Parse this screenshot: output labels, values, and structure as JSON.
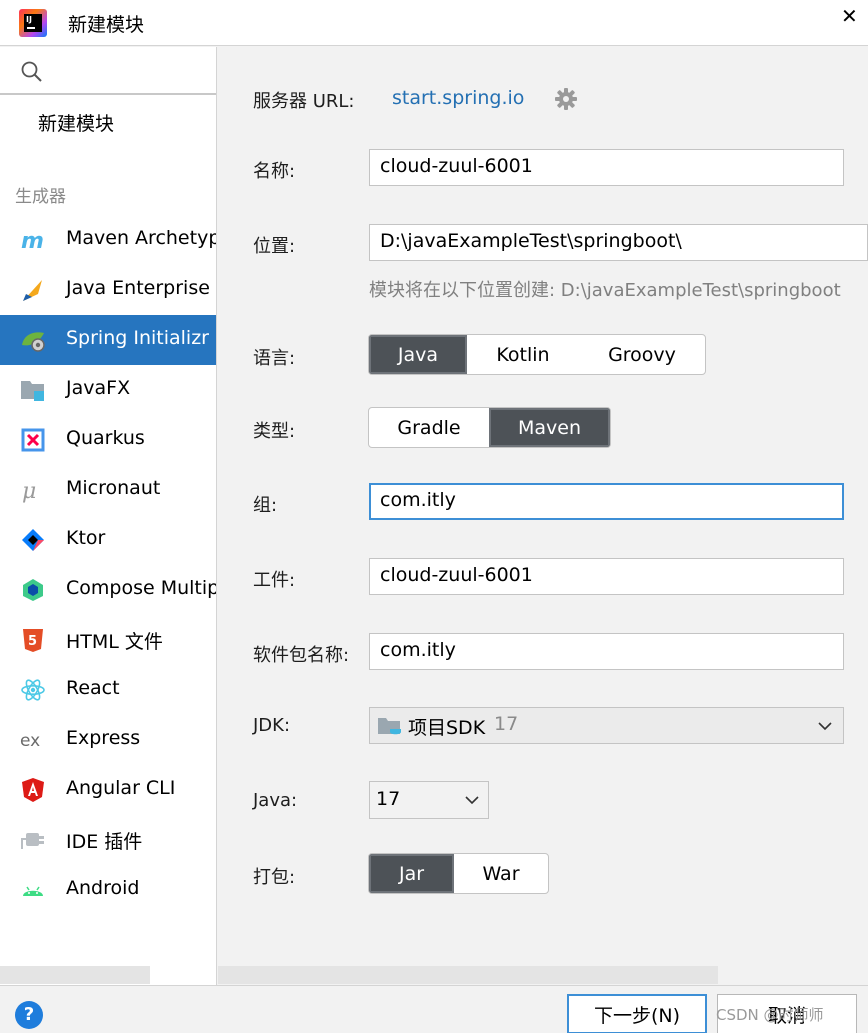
{
  "window": {
    "title": "新建模块",
    "close_glyph": "✕",
    "app_icon": "intellij-idea-icon",
    "logo_text": "IJ"
  },
  "sidebar": {
    "search_icon": "search-icon",
    "new_module_label": "新建模块",
    "group_label": "生成器",
    "generators": [
      {
        "label": "Maven Archetype",
        "icon": "maven-icon",
        "selected": false
      },
      {
        "label": "Java Enterprise",
        "icon": "java-enterprise-icon",
        "selected": false
      },
      {
        "label": "Spring Initializr",
        "icon": "spring-icon",
        "selected": true
      },
      {
        "label": "JavaFX",
        "icon": "javafx-icon",
        "selected": false
      },
      {
        "label": "Quarkus",
        "icon": "quarkus-icon",
        "selected": false
      },
      {
        "label": "Micronaut",
        "icon": "micronaut-icon",
        "selected": false
      },
      {
        "label": "Ktor",
        "icon": "ktor-icon",
        "selected": false
      },
      {
        "label": "Compose Multiplatform",
        "icon": "compose-icon",
        "selected": false
      },
      {
        "label": "HTML 文件",
        "icon": "html5-icon",
        "selected": false
      },
      {
        "label": "React",
        "icon": "react-icon",
        "selected": false
      },
      {
        "label": "Express",
        "icon": "express-icon",
        "selected": false
      },
      {
        "label": "Angular CLI",
        "icon": "angular-icon",
        "selected": false
      },
      {
        "label": "IDE 插件",
        "icon": "plugin-icon",
        "selected": false
      },
      {
        "label": "Android",
        "icon": "android-icon",
        "selected": false
      }
    ]
  },
  "form": {
    "server_url_label": "服务器 URL:",
    "server_url_value": "start.spring.io",
    "name_label": "名称:",
    "name_value": "cloud-zuul-6001",
    "location_label": "位置:",
    "location_value": "D:\\javaExampleTest\\springboot\\",
    "location_hint": "模块将在以下位置创建: D:\\javaExampleTest\\springboot",
    "language_label": "语言:",
    "language_options": [
      "Java",
      "Kotlin",
      "Groovy"
    ],
    "language_selected": "Java",
    "type_label": "类型:",
    "type_options": [
      "Gradle",
      "Maven"
    ],
    "type_selected": "Maven",
    "group_label": "组:",
    "group_value": "com.itly",
    "artifact_label": "工件:",
    "artifact_value": "cloud-zuul-6001",
    "package_label": "软件包名称:",
    "package_value": "com.itly",
    "jdk_label": "JDK:",
    "jdk_value": "项目SDK",
    "jdk_version": "17",
    "java_label": "Java:",
    "java_value": "17",
    "packaging_label": "打包:",
    "packaging_options": [
      "Jar",
      "War"
    ],
    "packaging_selected": "Jar"
  },
  "footer": {
    "help_glyph": "?",
    "next_label": "下一步(N)",
    "cancel_label": "取消",
    "watermark": "CSDN @时师师"
  },
  "colors": {
    "accent": "#2675bf",
    "link": "#2470b3",
    "selected_segment": "#4d5257",
    "focus_border": "#3d8fd6"
  }
}
